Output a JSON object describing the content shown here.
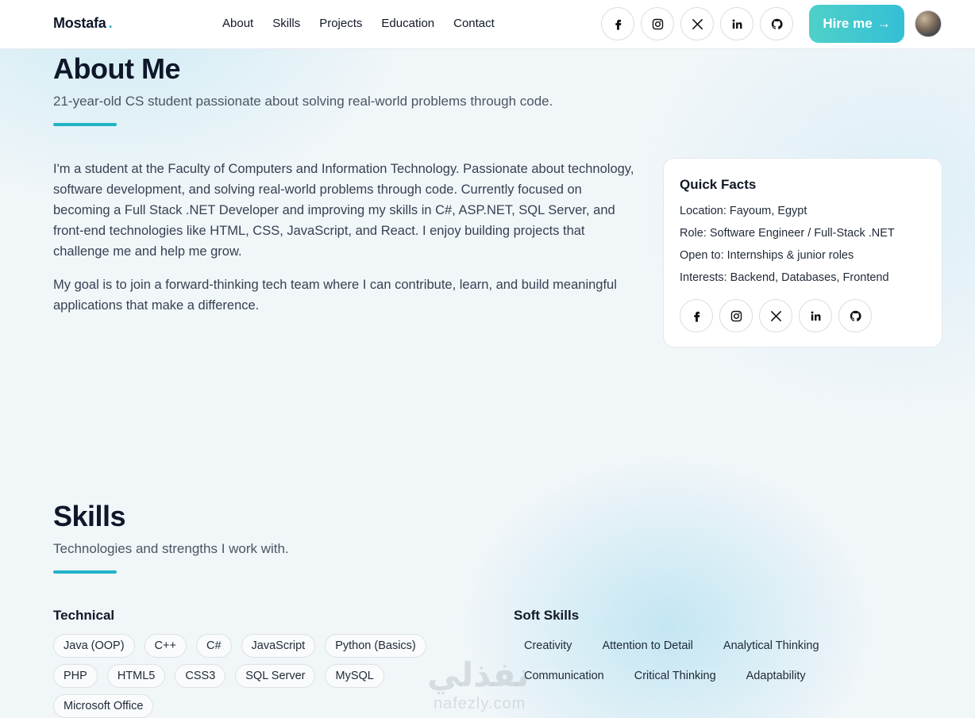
{
  "header": {
    "logo": "Mostafa",
    "logo_dot": ".",
    "nav": [
      "About",
      "Skills",
      "Projects",
      "Education",
      "Contact"
    ],
    "social": [
      "facebook-icon",
      "instagram-icon",
      "x-icon",
      "linkedin-icon",
      "github-icon"
    ],
    "hire_label": "Hire me",
    "hire_icon": "→"
  },
  "about": {
    "title": "About Me",
    "subtitle": "21-year-old CS student passionate about solving real-world problems through code.",
    "paragraphs": [
      "I'm a student at the Faculty of Computers and Information Technology. Passionate about technology, software development, and solving real-world problems through code. Currently focused on becoming a Full Stack .NET Developer and improving my skills in C#, ASP.NET, SQL Server, and front-end technologies like HTML, CSS, JavaScript, and React. I enjoy building projects that challenge me and help me grow.",
      "My goal is to join a forward-thinking tech team where I can contribute, learn, and build meaningful applications that make a difference."
    ],
    "quick_facts": {
      "title": "Quick Facts",
      "items": [
        "Location: Fayoum, Egypt",
        "Role: Software Engineer / Full-Stack .NET",
        "Open to: Internships & junior roles",
        "Interests: Backend, Databases, Frontend"
      ]
    }
  },
  "skills": {
    "title": "Skills",
    "subtitle": "Technologies and strengths I work with.",
    "technical_title": "Technical",
    "technical": [
      "Java (OOP)",
      "C++",
      "C#",
      "JavaScript",
      "Python (Basics)",
      "PHP",
      "HTML5",
      "CSS3",
      "SQL Server",
      "MySQL",
      "Microsoft Office"
    ],
    "soft_title": "Soft Skills",
    "soft": [
      "Creativity",
      "Attention to Detail",
      "Analytical Thinking",
      "Communication",
      "Critical Thinking",
      "Adaptability"
    ]
  },
  "watermark": {
    "logo": "نفذلي",
    "text": "nafezly.com"
  },
  "colors": {
    "accent": "#1fb3c8",
    "hire_gradient_start": "#4fd0c9",
    "hire_gradient_end": "#34bfd6",
    "heading": "#0f172a"
  }
}
